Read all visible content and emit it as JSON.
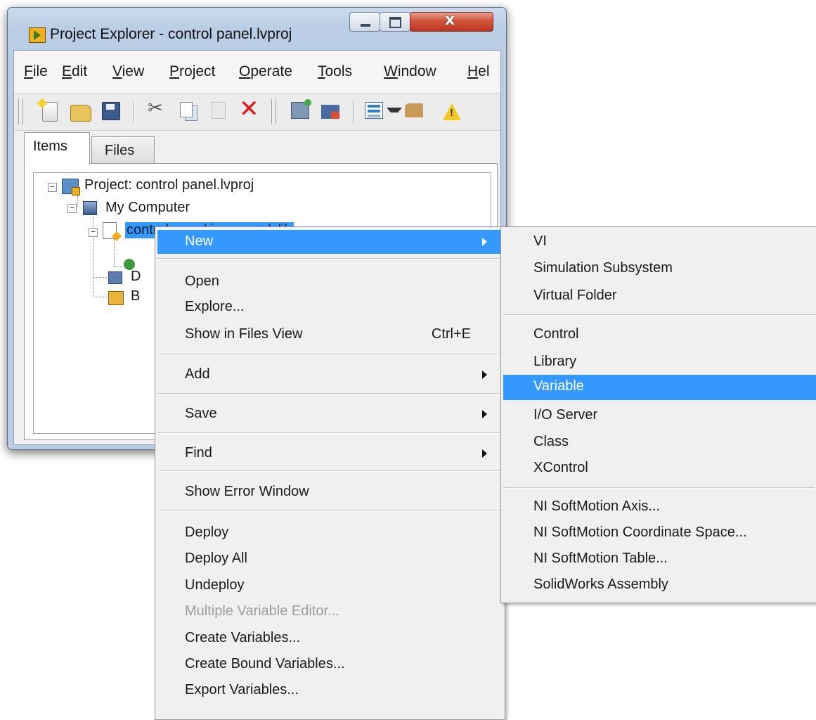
{
  "window": {
    "title": "Project Explorer - control panel.lvproj",
    "close_glyph": "x"
  },
  "menubar": {
    "items": [
      "File",
      "Edit",
      "View",
      "Project",
      "Operate",
      "Tools",
      "Window",
      "Hel"
    ]
  },
  "toolbar": {
    "icons": [
      "new-vi-icon",
      "open-folder-icon",
      "save-all-icon",
      "cut-icon",
      "copy-icon",
      "paste-icon",
      "delete-icon",
      "deploy-icon",
      "build-icon",
      "view-options-icon",
      "probe-icon",
      "warning-icon"
    ],
    "cut_glyph": "✂",
    "delete_glyph": "✕"
  },
  "tabs": [
    "Items",
    "Files"
  ],
  "tree": {
    "expander_glyph": "−",
    "project": "Project: control panel.lvproj",
    "computer": "My Computer",
    "library": "control panel io server.lvlib",
    "deps_partial": "D",
    "build_partial": "B"
  },
  "context_menu": {
    "items": [
      {
        "label": "New",
        "submenu": true
      },
      {
        "label": "Open"
      },
      {
        "label": "Explore..."
      },
      {
        "label": "Show in Files View",
        "shortcut": "Ctrl+E"
      },
      {
        "label": "Add",
        "submenu": true
      },
      {
        "label": "Save",
        "submenu": true
      },
      {
        "label": "Find",
        "submenu": true
      },
      {
        "label": "Show Error Window"
      },
      {
        "label": "Deploy"
      },
      {
        "label": "Deploy All"
      },
      {
        "label": "Undeploy"
      },
      {
        "label": "Multiple Variable Editor...",
        "disabled": true
      },
      {
        "label": "Create Variables..."
      },
      {
        "label": "Create Bound Variables..."
      },
      {
        "label": "Export Variables..."
      }
    ]
  },
  "submenu": {
    "items": [
      "VI",
      "Simulation Subsystem",
      "Virtual Folder",
      "Control",
      "Library",
      "Variable",
      "I/O Server",
      "Class",
      "XControl",
      "NI SoftMotion Axis...",
      "NI SoftMotion Coordinate Space...",
      "NI SoftMotion Table...",
      "SolidWorks Assembly"
    ],
    "highlighted": "Variable"
  },
  "colors": {
    "highlight": "#3399ff",
    "menu_bg": "#f0f0f0",
    "disabled_text": "#9c9c9c"
  }
}
